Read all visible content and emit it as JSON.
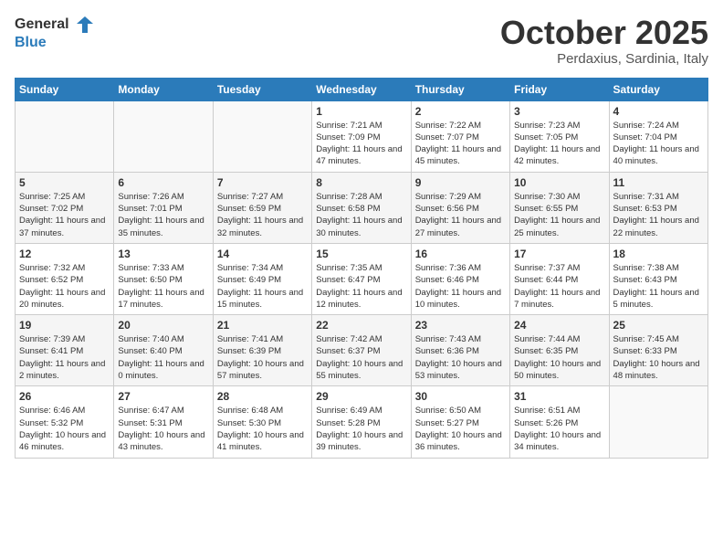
{
  "logo": {
    "general": "General",
    "blue": "Blue"
  },
  "header": {
    "month": "October 2025",
    "location": "Perdaxius, Sardinia, Italy"
  },
  "weekdays": [
    "Sunday",
    "Monday",
    "Tuesday",
    "Wednesday",
    "Thursday",
    "Friday",
    "Saturday"
  ],
  "weeks": [
    [
      {
        "day": "",
        "info": ""
      },
      {
        "day": "",
        "info": ""
      },
      {
        "day": "",
        "info": ""
      },
      {
        "day": "1",
        "info": "Sunrise: 7:21 AM\nSunset: 7:09 PM\nDaylight: 11 hours and 47 minutes."
      },
      {
        "day": "2",
        "info": "Sunrise: 7:22 AM\nSunset: 7:07 PM\nDaylight: 11 hours and 45 minutes."
      },
      {
        "day": "3",
        "info": "Sunrise: 7:23 AM\nSunset: 7:05 PM\nDaylight: 11 hours and 42 minutes."
      },
      {
        "day": "4",
        "info": "Sunrise: 7:24 AM\nSunset: 7:04 PM\nDaylight: 11 hours and 40 minutes."
      }
    ],
    [
      {
        "day": "5",
        "info": "Sunrise: 7:25 AM\nSunset: 7:02 PM\nDaylight: 11 hours and 37 minutes."
      },
      {
        "day": "6",
        "info": "Sunrise: 7:26 AM\nSunset: 7:01 PM\nDaylight: 11 hours and 35 minutes."
      },
      {
        "day": "7",
        "info": "Sunrise: 7:27 AM\nSunset: 6:59 PM\nDaylight: 11 hours and 32 minutes."
      },
      {
        "day": "8",
        "info": "Sunrise: 7:28 AM\nSunset: 6:58 PM\nDaylight: 11 hours and 30 minutes."
      },
      {
        "day": "9",
        "info": "Sunrise: 7:29 AM\nSunset: 6:56 PM\nDaylight: 11 hours and 27 minutes."
      },
      {
        "day": "10",
        "info": "Sunrise: 7:30 AM\nSunset: 6:55 PM\nDaylight: 11 hours and 25 minutes."
      },
      {
        "day": "11",
        "info": "Sunrise: 7:31 AM\nSunset: 6:53 PM\nDaylight: 11 hours and 22 minutes."
      }
    ],
    [
      {
        "day": "12",
        "info": "Sunrise: 7:32 AM\nSunset: 6:52 PM\nDaylight: 11 hours and 20 minutes."
      },
      {
        "day": "13",
        "info": "Sunrise: 7:33 AM\nSunset: 6:50 PM\nDaylight: 11 hours and 17 minutes."
      },
      {
        "day": "14",
        "info": "Sunrise: 7:34 AM\nSunset: 6:49 PM\nDaylight: 11 hours and 15 minutes."
      },
      {
        "day": "15",
        "info": "Sunrise: 7:35 AM\nSunset: 6:47 PM\nDaylight: 11 hours and 12 minutes."
      },
      {
        "day": "16",
        "info": "Sunrise: 7:36 AM\nSunset: 6:46 PM\nDaylight: 11 hours and 10 minutes."
      },
      {
        "day": "17",
        "info": "Sunrise: 7:37 AM\nSunset: 6:44 PM\nDaylight: 11 hours and 7 minutes."
      },
      {
        "day": "18",
        "info": "Sunrise: 7:38 AM\nSunset: 6:43 PM\nDaylight: 11 hours and 5 minutes."
      }
    ],
    [
      {
        "day": "19",
        "info": "Sunrise: 7:39 AM\nSunset: 6:41 PM\nDaylight: 11 hours and 2 minutes."
      },
      {
        "day": "20",
        "info": "Sunrise: 7:40 AM\nSunset: 6:40 PM\nDaylight: 11 hours and 0 minutes."
      },
      {
        "day": "21",
        "info": "Sunrise: 7:41 AM\nSunset: 6:39 PM\nDaylight: 10 hours and 57 minutes."
      },
      {
        "day": "22",
        "info": "Sunrise: 7:42 AM\nSunset: 6:37 PM\nDaylight: 10 hours and 55 minutes."
      },
      {
        "day": "23",
        "info": "Sunrise: 7:43 AM\nSunset: 6:36 PM\nDaylight: 10 hours and 53 minutes."
      },
      {
        "day": "24",
        "info": "Sunrise: 7:44 AM\nSunset: 6:35 PM\nDaylight: 10 hours and 50 minutes."
      },
      {
        "day": "25",
        "info": "Sunrise: 7:45 AM\nSunset: 6:33 PM\nDaylight: 10 hours and 48 minutes."
      }
    ],
    [
      {
        "day": "26",
        "info": "Sunrise: 6:46 AM\nSunset: 5:32 PM\nDaylight: 10 hours and 46 minutes."
      },
      {
        "day": "27",
        "info": "Sunrise: 6:47 AM\nSunset: 5:31 PM\nDaylight: 10 hours and 43 minutes."
      },
      {
        "day": "28",
        "info": "Sunrise: 6:48 AM\nSunset: 5:30 PM\nDaylight: 10 hours and 41 minutes."
      },
      {
        "day": "29",
        "info": "Sunrise: 6:49 AM\nSunset: 5:28 PM\nDaylight: 10 hours and 39 minutes."
      },
      {
        "day": "30",
        "info": "Sunrise: 6:50 AM\nSunset: 5:27 PM\nDaylight: 10 hours and 36 minutes."
      },
      {
        "day": "31",
        "info": "Sunrise: 6:51 AM\nSunset: 5:26 PM\nDaylight: 10 hours and 34 minutes."
      },
      {
        "day": "",
        "info": ""
      }
    ]
  ]
}
